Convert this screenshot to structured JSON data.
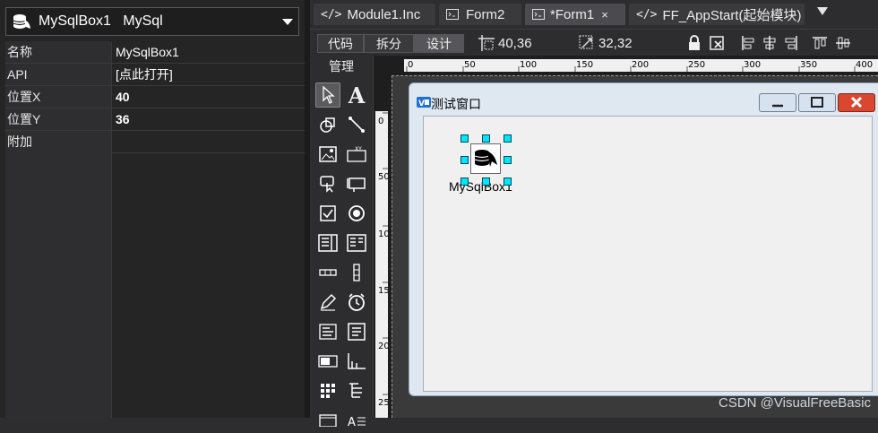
{
  "object_selector": {
    "value": "MySqlBox1   MySql"
  },
  "properties": [
    {
      "name": "名称",
      "value": "MySqlBox1",
      "bold": false
    },
    {
      "name": "API",
      "value": "[点此打开]",
      "bold": false
    },
    {
      "name": "位置X",
      "value": "40",
      "bold": true
    },
    {
      "name": "位置Y",
      "value": "36",
      "bold": true
    },
    {
      "name": "附加",
      "value": "",
      "bold": false
    }
  ],
  "tabs": [
    {
      "label": "Module1.Inc",
      "icon": "</>"
    },
    {
      "label": "Form2",
      "icon": "form"
    },
    {
      "label": "*Form1",
      "icon": "form",
      "active": true,
      "close": "×"
    },
    {
      "label": "FF_AppStart(起始模块)",
      "icon": "</>"
    }
  ],
  "toolbar": {
    "modes": [
      "代码",
      "拆分",
      "设计"
    ],
    "position": "40,36",
    "size": "32,32"
  },
  "toolbox": {
    "title": "管理"
  },
  "ruler": {
    "top_ticks": [
      "0",
      "50",
      "100",
      "150",
      "200",
      "250",
      "300",
      "350",
      "400"
    ],
    "left_ticks": [
      "0",
      "50",
      "100",
      "150",
      "200",
      "250"
    ]
  },
  "form": {
    "title": "测试窗口",
    "component_label": "MySqlBox1"
  },
  "watermark": "CSDN @VisualFreeBasic"
}
